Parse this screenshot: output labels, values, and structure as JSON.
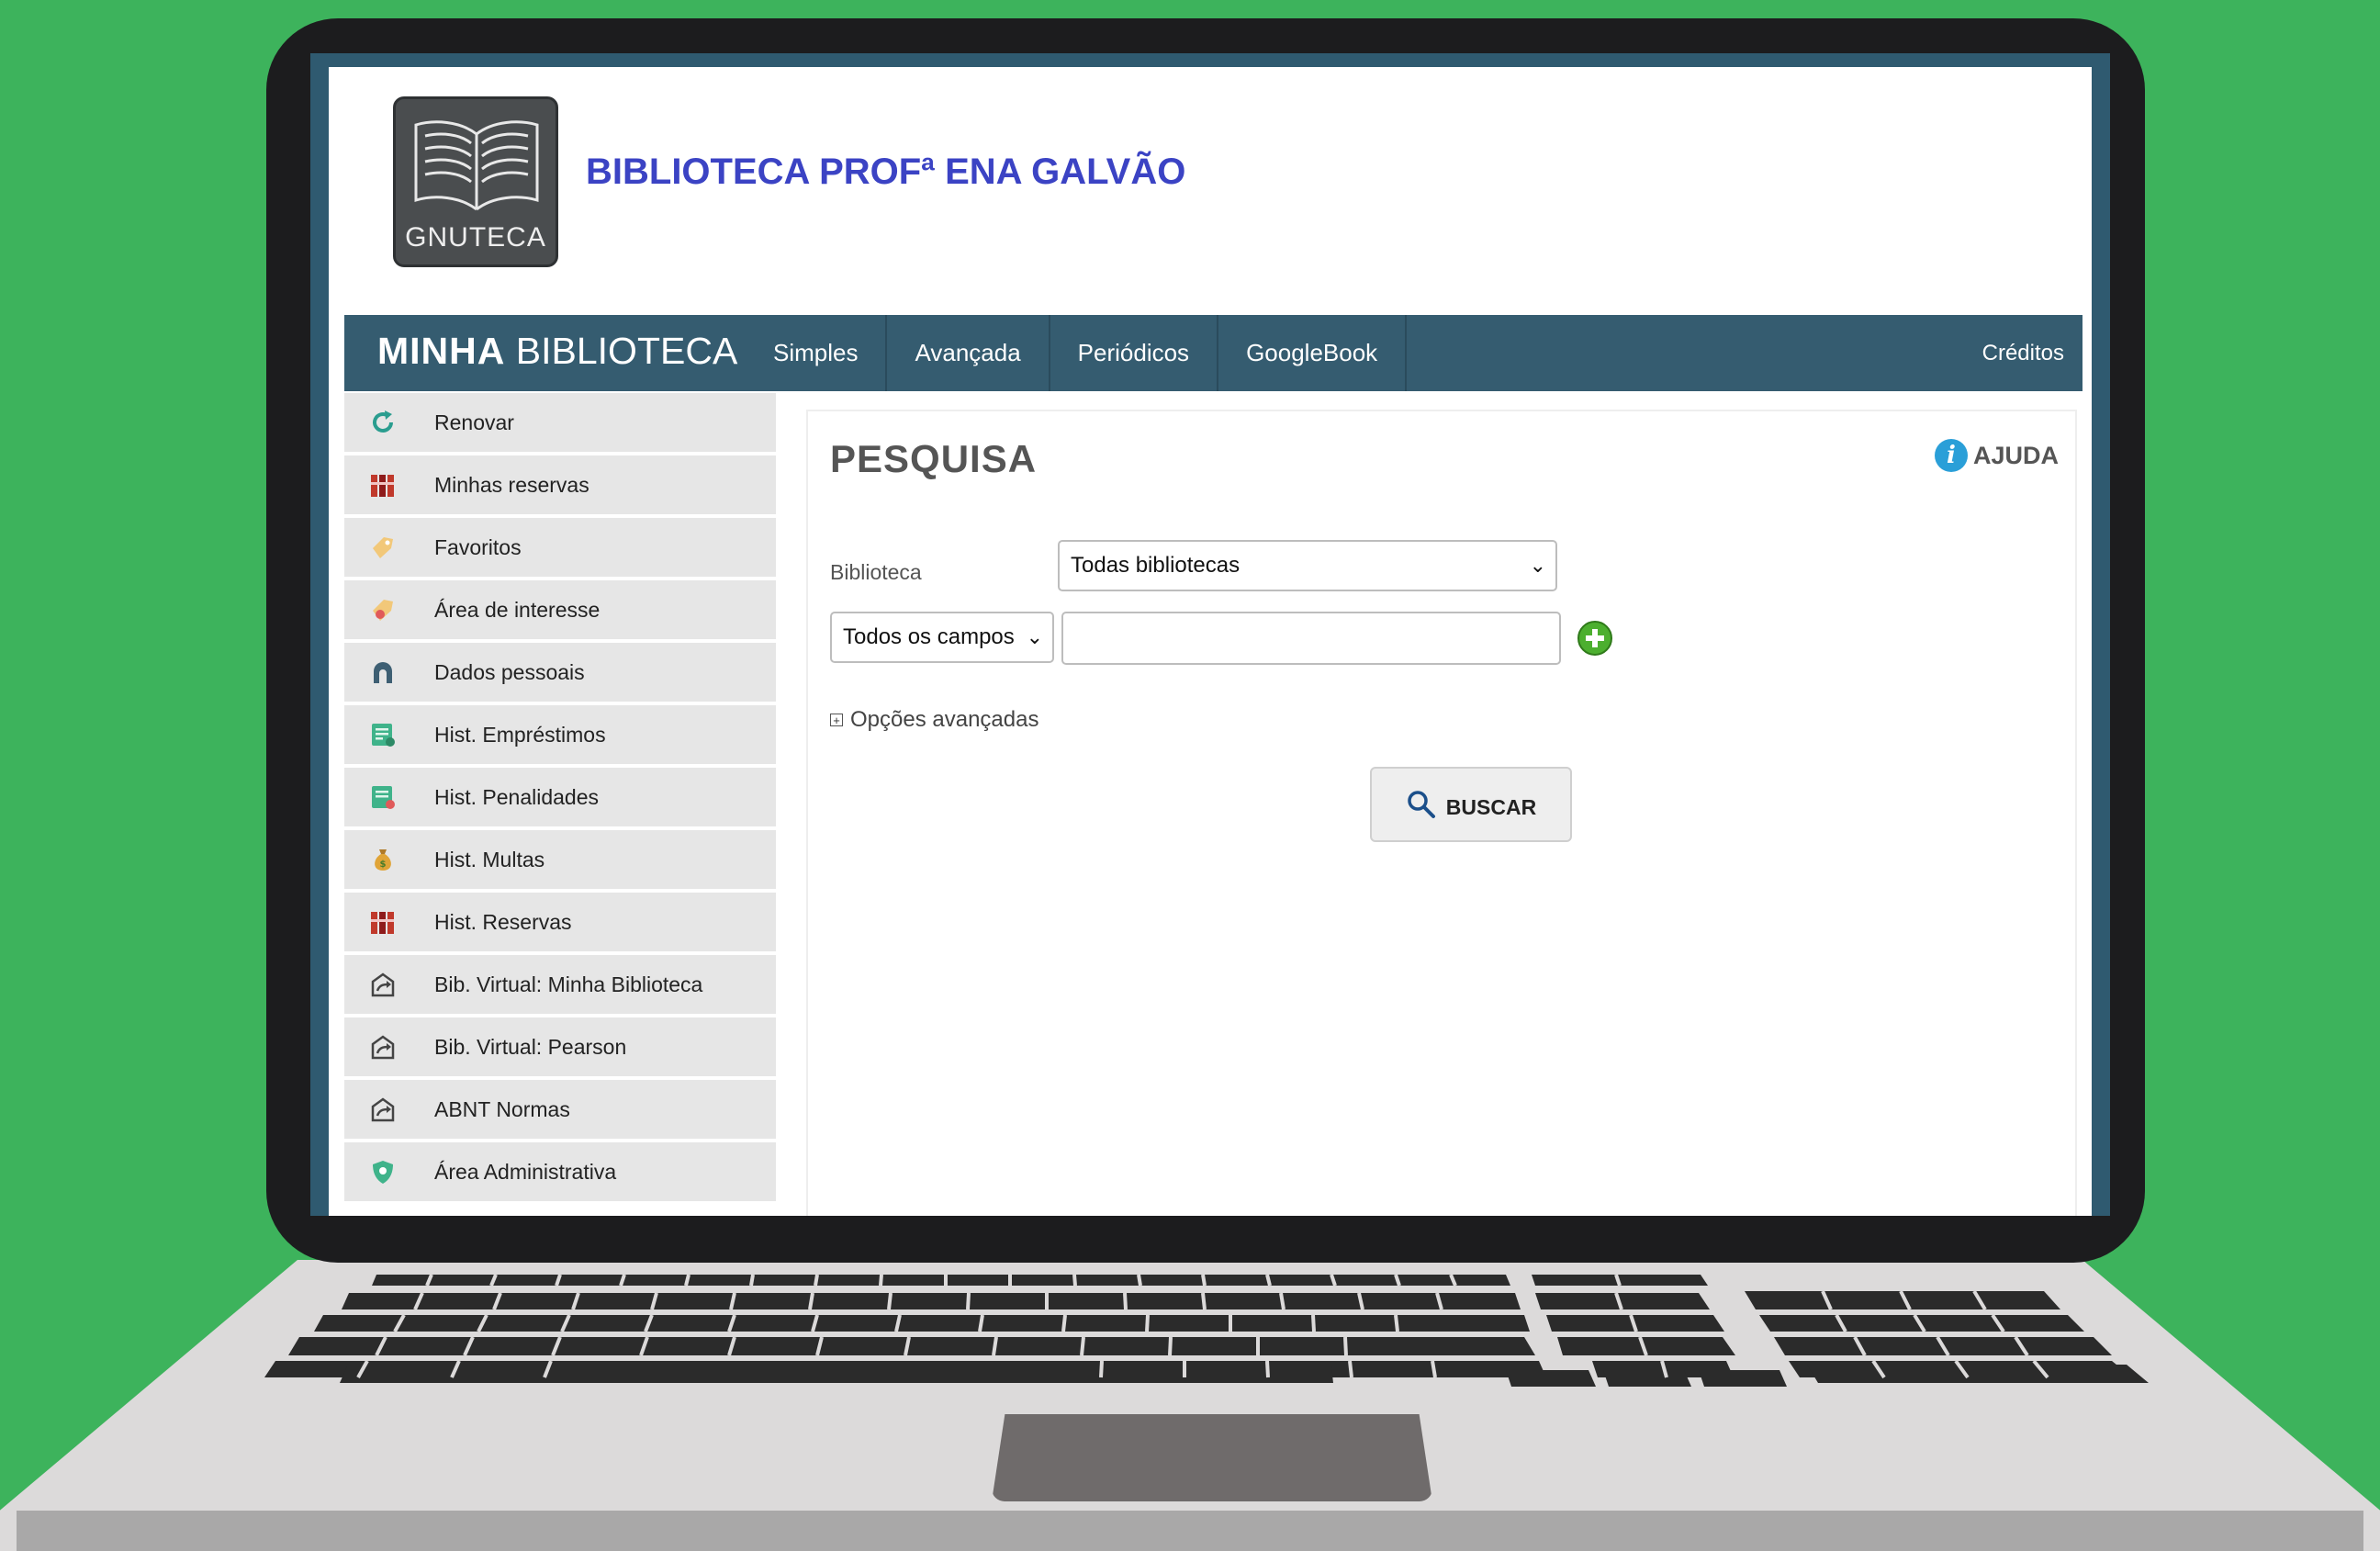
{
  "header": {
    "logo_text": "GNUTECA",
    "site_title": "BIBLIOTECA PROFª ENA GALVÃO"
  },
  "navbar": {
    "brand_bold": "MINHA",
    "brand_regular": "BIBLIOTECA",
    "items": [
      {
        "label": "Simples"
      },
      {
        "label": "Avançada"
      },
      {
        "label": "Periódicos"
      },
      {
        "label": "GoogleBook"
      }
    ],
    "credits": "Créditos"
  },
  "sidebar": {
    "items": [
      {
        "label": "Renovar",
        "icon": "refresh-icon"
      },
      {
        "label": "Minhas reservas",
        "icon": "books-icon"
      },
      {
        "label": "Favoritos",
        "icon": "favorite-icon"
      },
      {
        "label": "Área de interesse",
        "icon": "interest-icon"
      },
      {
        "label": "Dados pessoais",
        "icon": "user-icon"
      },
      {
        "label": "Hist. Empréstimos",
        "icon": "loan-history-icon"
      },
      {
        "label": "Hist. Penalidades",
        "icon": "penalty-history-icon"
      },
      {
        "label": "Hist. Multas",
        "icon": "money-bag-icon"
      },
      {
        "label": "Hist. Reservas",
        "icon": "books-icon"
      },
      {
        "label": "Bib. Virtual: Minha Biblioteca",
        "icon": "external-link-icon"
      },
      {
        "label": "Bib. Virtual: Pearson",
        "icon": "external-link-icon"
      },
      {
        "label": "ABNT Normas",
        "icon": "external-link-icon"
      },
      {
        "label": "Área Administrativa",
        "icon": "shield-icon"
      }
    ]
  },
  "search": {
    "title": "PESQUISA",
    "help_label": "AJUDA",
    "biblioteca_label": "Biblioteca",
    "biblioteca_value": "Todas bibliotecas",
    "field_value": "Todos os campos",
    "query_value": "",
    "advanced_label": "Opções avançadas",
    "search_button": "BUSCAR"
  },
  "colors": {
    "background": "#3db35c",
    "navbar": "#355c70",
    "title": "#3b43c4",
    "add_button": "#4caf2f",
    "help_icon": "#2a9fd8"
  }
}
